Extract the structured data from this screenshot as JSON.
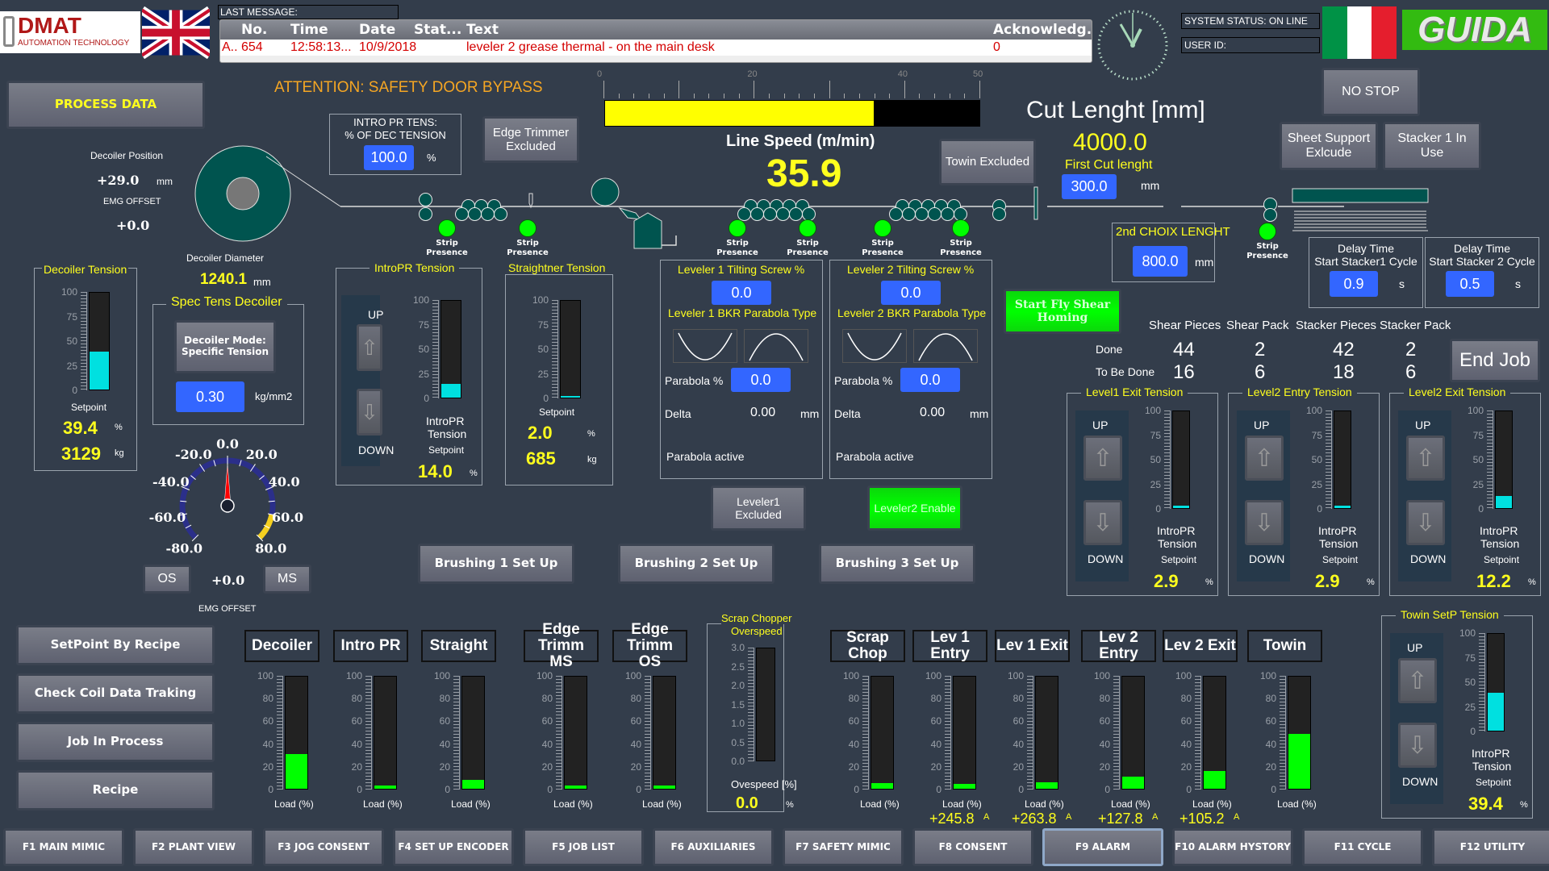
{
  "header": {
    "logo_brand": "DMAT",
    "logo_sub": "AUTOMATION TECHNOLOGY",
    "last_message_label": "LAST MESSAGE:",
    "alarm_columns": [
      "No.",
      "Time",
      "Date",
      "Stat...",
      "Text",
      "Acknowledg..."
    ],
    "alarm_row": {
      "type": "A..",
      "no": "654",
      "time": "12:58:13...",
      "date": "10/9/2018",
      "status": "",
      "text": "leveler 2 grease thermal - on the main desk",
      "ack": "0"
    },
    "system_status": "SYSTEM STATUS: ON LINE",
    "user_id": "USER ID:",
    "guida_logo": "GUIDA",
    "clock_time": "11:59"
  },
  "buttons": {
    "process_data": "PROCESS DATA",
    "no_stop": "NO STOP",
    "sheet_support": "Sheet Support Exlcude",
    "stacker1": "Stacker 1 In Use",
    "edge_trimmer": "Edge Trimmer Excluded",
    "towin_excluded": "Towin Excluded",
    "start_fly_shear": "Start  Fly Shear Homing",
    "end_job": "End Job",
    "leveler1_excluded": "Leveler1 Excluded",
    "leveler2_enable": "Leveler2 Enable",
    "brushing1": "Brushing 1 Set Up",
    "brushing2": "Brushing 2 Set Up",
    "brushing3": "Brushing 3 Set Up",
    "os": "OS",
    "ms": "MS",
    "setpoint_recipe": "SetPoint By Recipe",
    "check_coil": "Check Coil Data Traking",
    "job_in_process": "Job In Process",
    "recipe": "Recipe",
    "decoiler_mode": "Decoiler Mode: Specific Tension"
  },
  "attention": "ATTENTION: SAFETY DOOR BYPASS",
  "decoiler": {
    "position_label": "Decoiler Position",
    "position_value": "+29.0",
    "position_unit": "mm",
    "emg_offset_label": "EMG OFFSET",
    "emg_offset_value": "+0.0",
    "diameter_label": "Decoiler Diameter",
    "diameter_value": "1240.1",
    "diameter_unit": "mm",
    "tension_title": "Decoiler Tension",
    "tension_fill_pct": 39.4,
    "setpoint_label": "Setpoint",
    "setpoint_pct": "39.4",
    "setpoint_kg": "3129",
    "pct_unit": "%",
    "kg_unit": "kg",
    "spec_title": "Spec Tens Decoiler",
    "spec_value": "0.30",
    "spec_unit": "kg/mm2"
  },
  "gauge": {
    "labels": [
      "-80.0",
      "-60.0",
      "-40.0",
      "-20.0",
      "0.0",
      "20.0",
      "40.0",
      "60.0",
      "80.0"
    ],
    "value": 0.0,
    "offset_value": "+0.0",
    "emg_offset_label": "EMG OFFSET"
  },
  "intro_pr_tens": {
    "title1": "INTRO PR TENS:",
    "title2": "% OF DEC TENSION",
    "value": "100.0",
    "unit": "%"
  },
  "line_speed": {
    "label": "Line Speed (m/min)",
    "value": "35.9",
    "scale": [
      "0",
      "20",
      "40",
      "50"
    ],
    "max": 50,
    "fill_value": 35.9
  },
  "cut_length": {
    "title": "Cut Lenght [mm]",
    "value": "4000.0",
    "first_cut_label": "First Cut lenght",
    "first_cut_value": "300.0",
    "unit": "mm",
    "second_choix_label": "2nd CHOIX LENGHT",
    "second_choix_value": "800.0"
  },
  "strip_presence": "Strip Presence",
  "intropr_tension": {
    "title": "IntroPR Tension",
    "up": "UP",
    "down": "DOWN",
    "fill_pct": 14.0,
    "label1": "IntroPR",
    "label2": "Tension",
    "setpoint": "Setpoint",
    "value": "14.0",
    "unit": "%"
  },
  "straightner_tension": {
    "title": "Straightner Tension",
    "fill_pct": 2.0,
    "setpoint": "Setpoint",
    "pct": "2.0",
    "kg": "685",
    "pct_unit": "%",
    "kg_unit": "kg"
  },
  "bar_scale_100": [
    "100",
    "75",
    "50",
    "25",
    "0"
  ],
  "load_scale": [
    "100",
    "80",
    "60",
    "40",
    "20",
    "0"
  ],
  "levelers": [
    {
      "title": "Leveler 1 Tilting Screw %",
      "tilt": "0.0",
      "bkr": "Leveler 1 BKR Parabola Type",
      "parabola_label": "Parabola %",
      "parabola": "0.0",
      "delta_label": "Delta",
      "delta": "0.00",
      "delta_unit": "mm",
      "active": "Parabola active"
    },
    {
      "title": "Leveler 2 Tilting Screw %",
      "tilt": "0.0",
      "bkr": "Leveler 2 BKR Parabola Type",
      "parabola_label": "Parabola %",
      "parabola": "0.0",
      "delta_label": "Delta",
      "delta": "0.00",
      "delta_unit": "mm",
      "active": "Parabola active"
    }
  ],
  "stacker_delay": [
    {
      "title1": "Delay Time",
      "title2": "Start Stacker1  Cycle",
      "value": "0.9",
      "unit": "s"
    },
    {
      "title1": "Delay Time",
      "title2": "Start Stacker 2 Cycle",
      "value": "0.5",
      "unit": "s"
    }
  ],
  "counters": {
    "headers": [
      "Shear Pieces",
      "Shear Pack",
      "Stacker Pieces",
      "Stacker Pack"
    ],
    "rows": [
      {
        "label": "Done",
        "values": [
          "44",
          "2",
          "42",
          "2"
        ]
      },
      {
        "label": "To Be Done",
        "values": [
          "16",
          "6",
          "18",
          "6"
        ]
      }
    ]
  },
  "tension_panels": [
    {
      "title": "Level1 Exit Tension",
      "fill_pct": 2.9,
      "value": "2.9"
    },
    {
      "title": "Level2 Entry Tension",
      "fill_pct": 2.9,
      "value": "2.9"
    },
    {
      "title": "Level2 Exit Tension",
      "fill_pct": 12.2,
      "value": "12.2"
    },
    {
      "title": "Towin SetP Tension",
      "fill_pct": 39.4,
      "value": "39.4"
    }
  ],
  "tension_common": {
    "up": "UP",
    "down": "DOWN",
    "label1": "IntroPR",
    "label2": "Tension",
    "setpoint": "Setpoint",
    "unit": "%"
  },
  "loads": [
    {
      "name": "Decoiler",
      "value": 31,
      "label": "Load (%)",
      "current": ""
    },
    {
      "name": "Intro PR",
      "value": 3,
      "label": "Load (%)",
      "current": ""
    },
    {
      "name": "Straight",
      "value": 8,
      "label": "Load (%)",
      "current": ""
    },
    {
      "name": "Edge Trimm MS",
      "value": 3,
      "label": "Load (%)",
      "current": ""
    },
    {
      "name": "Edge Trimm OS",
      "value": 3,
      "label": "Load (%)",
      "current": ""
    },
    {
      "name": "Scrap Chop",
      "value": 5,
      "label": "Load (%)",
      "current": ""
    },
    {
      "name": "Lev 1 Entry",
      "value": 4,
      "label": "Load (%)",
      "current": "+245.8"
    },
    {
      "name": "Lev 1 Exit",
      "value": 6,
      "label": "Load (%)",
      "current": "+263.8"
    },
    {
      "name": "Lev 2 Entry",
      "value": 11,
      "label": "Load (%)",
      "current": "+127.8"
    },
    {
      "name": "Lev 2 Exit",
      "value": 16,
      "label": "Load (%)",
      "current": "+105.2"
    },
    {
      "name": "Towin",
      "value": 49,
      "label": "Load (%)",
      "current": ""
    }
  ],
  "current_unit": "A",
  "scrap_overspeed": {
    "title1": "Scrap Chopper",
    "title2": "Overspeed",
    "scale": [
      "3.0",
      "2.5",
      "2.0",
      "1.5",
      "1.0",
      "0.5",
      "0.0"
    ],
    "fill": 0.0,
    "label": "Ovespeed [%]",
    "value": "0.0",
    "unit": "%"
  },
  "fkeys": [
    "F1  MAIN MIMIC",
    "F2  PLANT VIEW",
    "F3  JOG CONSENT",
    "F4 SET UP ENCODER",
    "F5 JOB LIST",
    "F6 AUXILIARIES",
    "F7  SAFETY MIMIC",
    "F8  CONSENT",
    "F9  ALARM",
    "F10  ALARM HYSTORY",
    "F11  CYCLE",
    "F12  UTILITY"
  ],
  "colors": {
    "background": "#333d4b",
    "accent_yellow": "#ffff1e",
    "input_blue": "#3366ff",
    "tension_cyan": "#00e0e0",
    "load_green": "#00ff00",
    "attention_orange": "#f5a623",
    "alarm_red": "#d40000"
  }
}
